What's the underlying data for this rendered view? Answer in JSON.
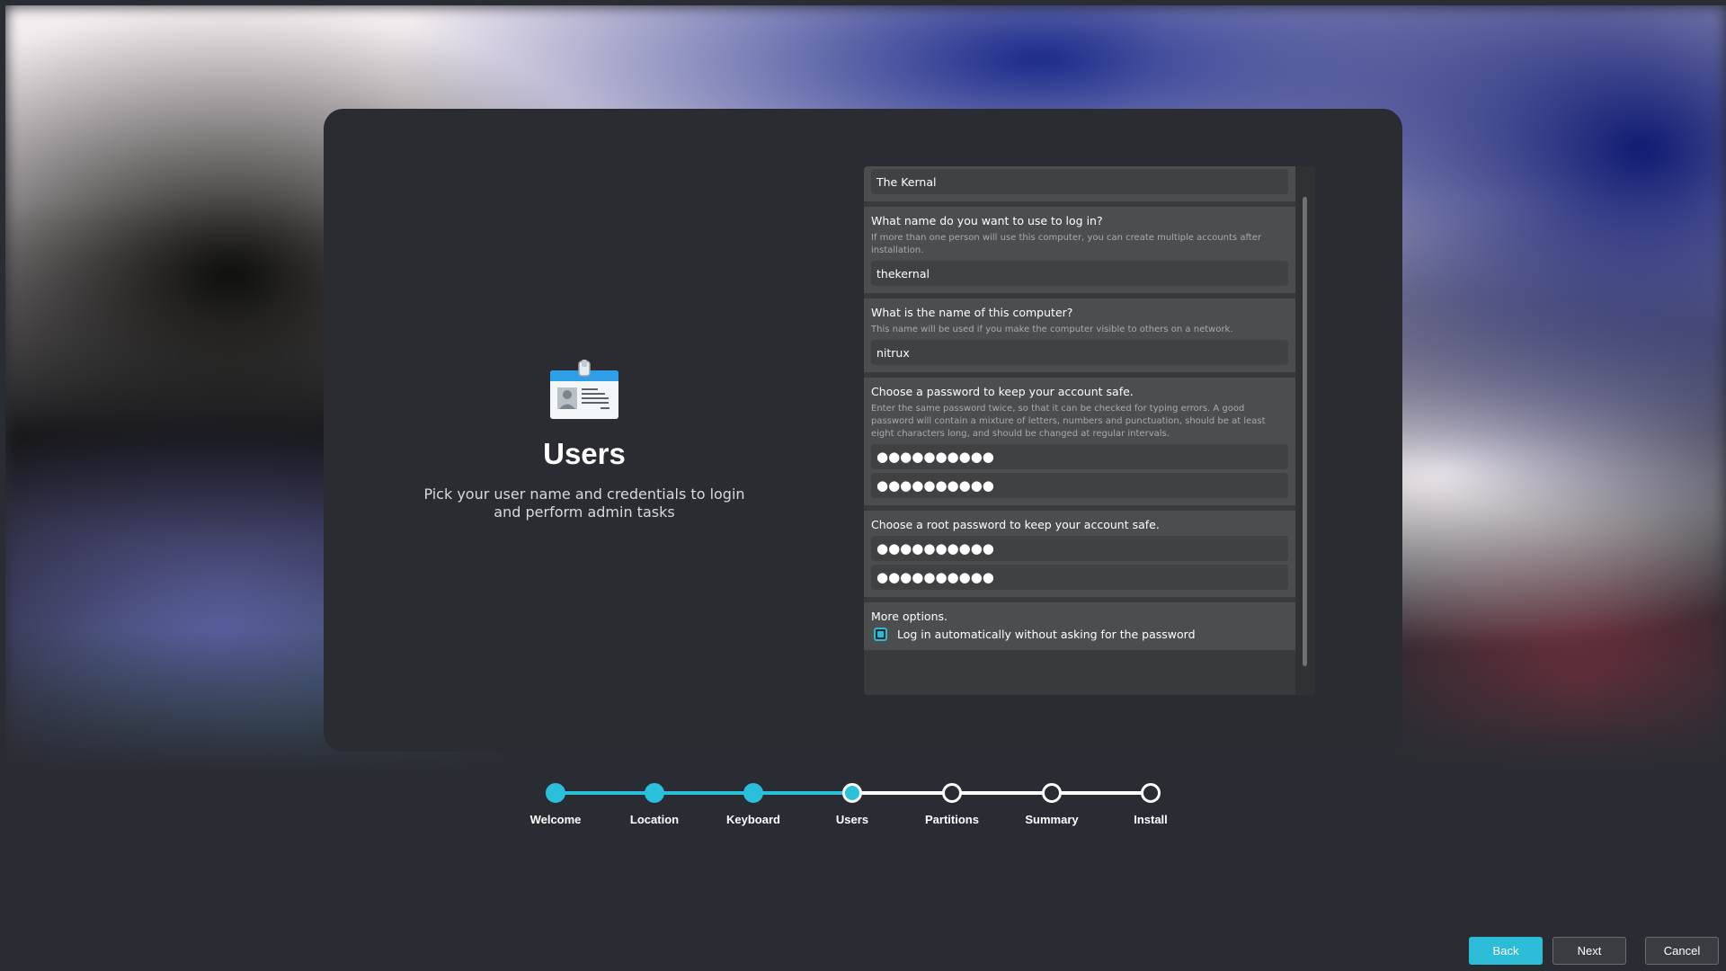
{
  "page": {
    "title": "Users",
    "subtitle": "Pick your user name and credentials to login and perform admin tasks"
  },
  "form": {
    "full_name_value": "The Kernal",
    "login": {
      "label": "What name do you want to use to log in?",
      "hint": "If more than one person will use this computer, you can create multiple accounts after installation.",
      "value": "thekernal"
    },
    "hostname": {
      "label": "What is the name of this computer?",
      "hint": "This name will be used if you make the computer visible to others on a network.",
      "value": "nitrux"
    },
    "password": {
      "label": "Choose a password to keep your account safe.",
      "hint": "Enter the same password twice, so that it can be checked for typing errors. A good password will contain a mixture of letters, numbers and punctuation, should be at least eight characters long, and should be changed at regular intervals.",
      "value": "●●●●●●●●●●",
      "confirm_value": "●●●●●●●●●●"
    },
    "root_password": {
      "label": "Choose a root password to keep your account safe.",
      "value": "●●●●●●●●●●",
      "confirm_value": "●●●●●●●●●●"
    },
    "more_options": {
      "label": "More options.",
      "autologin_label": "Log in automatically without asking for the password",
      "autologin_checked": true
    }
  },
  "steps": [
    {
      "label": "Welcome",
      "state": "done"
    },
    {
      "label": "Location",
      "state": "done"
    },
    {
      "label": "Keyboard",
      "state": "done"
    },
    {
      "label": "Users",
      "state": "current"
    },
    {
      "label": "Partitions",
      "state": "pending"
    },
    {
      "label": "Summary",
      "state": "pending"
    },
    {
      "label": "Install",
      "state": "pending"
    }
  ],
  "buttons": {
    "back": "Back",
    "next": "Next",
    "cancel": "Cancel"
  },
  "colors": {
    "accent": "#2ac0dc",
    "dialog_bg": "#2a2c31",
    "section_bg": "#4b4d4f"
  },
  "icons": {
    "page_icon": "id-badge-icon"
  }
}
